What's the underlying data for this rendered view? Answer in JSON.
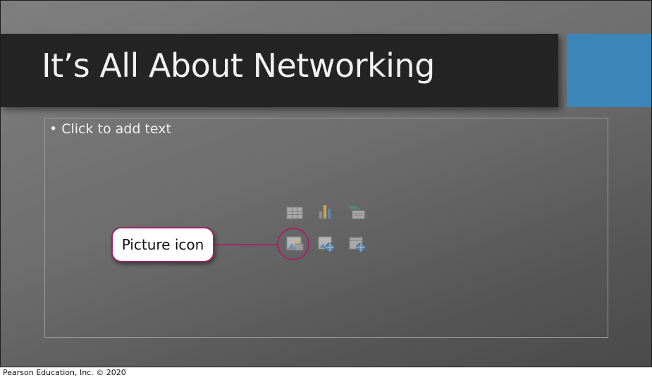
{
  "slide": {
    "title": "It’s All About Networking",
    "bullet_marker": "•",
    "placeholder_text": "Click to add text"
  },
  "content_icons": [
    {
      "name": "insert-table-icon"
    },
    {
      "name": "insert-chart-icon"
    },
    {
      "name": "insert-smartart-icon"
    },
    {
      "name": "pictures-icon"
    },
    {
      "name": "online-pictures-icon"
    },
    {
      "name": "insert-video-icon"
    }
  ],
  "callout": {
    "label": "Picture icon"
  },
  "footer": {
    "copyright": "Pearson Education, Inc. © 2020"
  },
  "colors": {
    "title_bar": "#242424",
    "accent_block": "#3b86b8",
    "callout_border": "#a0256a"
  }
}
